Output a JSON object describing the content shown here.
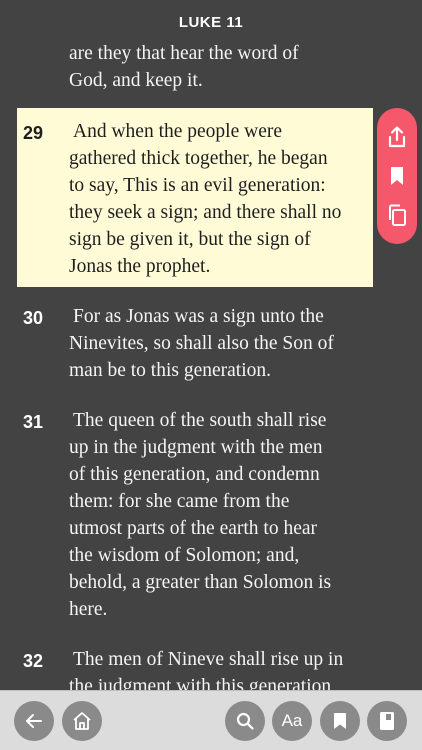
{
  "header": {
    "title": "LUKE 11"
  },
  "verses": [
    {
      "number": "",
      "lines": [
        "are they that hear the word of",
        "God, and keep it."
      ]
    },
    {
      "number": "29",
      "lines": [
        "And when the people were",
        "gathered thick together, he began",
        "to say, This is an evil generation:",
        "they seek a sign; and there shall no",
        "sign be given it, but the sign of",
        "Jonas the prophet."
      ],
      "highlighted": true
    },
    {
      "number": "30",
      "lines": [
        "For as Jonas was a sign unto the",
        "Ninevites, so shall also the Son of",
        "man be to this generation."
      ]
    },
    {
      "number": "31",
      "lines": [
        "The queen of the south shall rise",
        "up in the judgment with the men",
        "of this generation, and condemn",
        "them: for she came from the",
        "utmost parts of the earth to hear",
        "the wisdom of Solomon; and,",
        "behold, a greater than Solomon is",
        "here."
      ]
    },
    {
      "number": "32",
      "lines": [
        "The men of Nineve shall rise up in",
        "the judgment with this generation"
      ]
    }
  ],
  "side_actions": [
    "share-icon",
    "bookmark-icon",
    "copy-icon"
  ],
  "footer": {
    "buttons": [
      "back-arrow-icon",
      "home-icon",
      "search-icon",
      "text-size",
      "bookmark-icon",
      "book-icon"
    ],
    "text_size_label": "Aa"
  },
  "colors": {
    "background": "#434343",
    "highlight": "#fffbd6",
    "accent": "#f4586a",
    "footer_bg": "#dcdcdc",
    "footer_button": "#8a8a8a"
  }
}
